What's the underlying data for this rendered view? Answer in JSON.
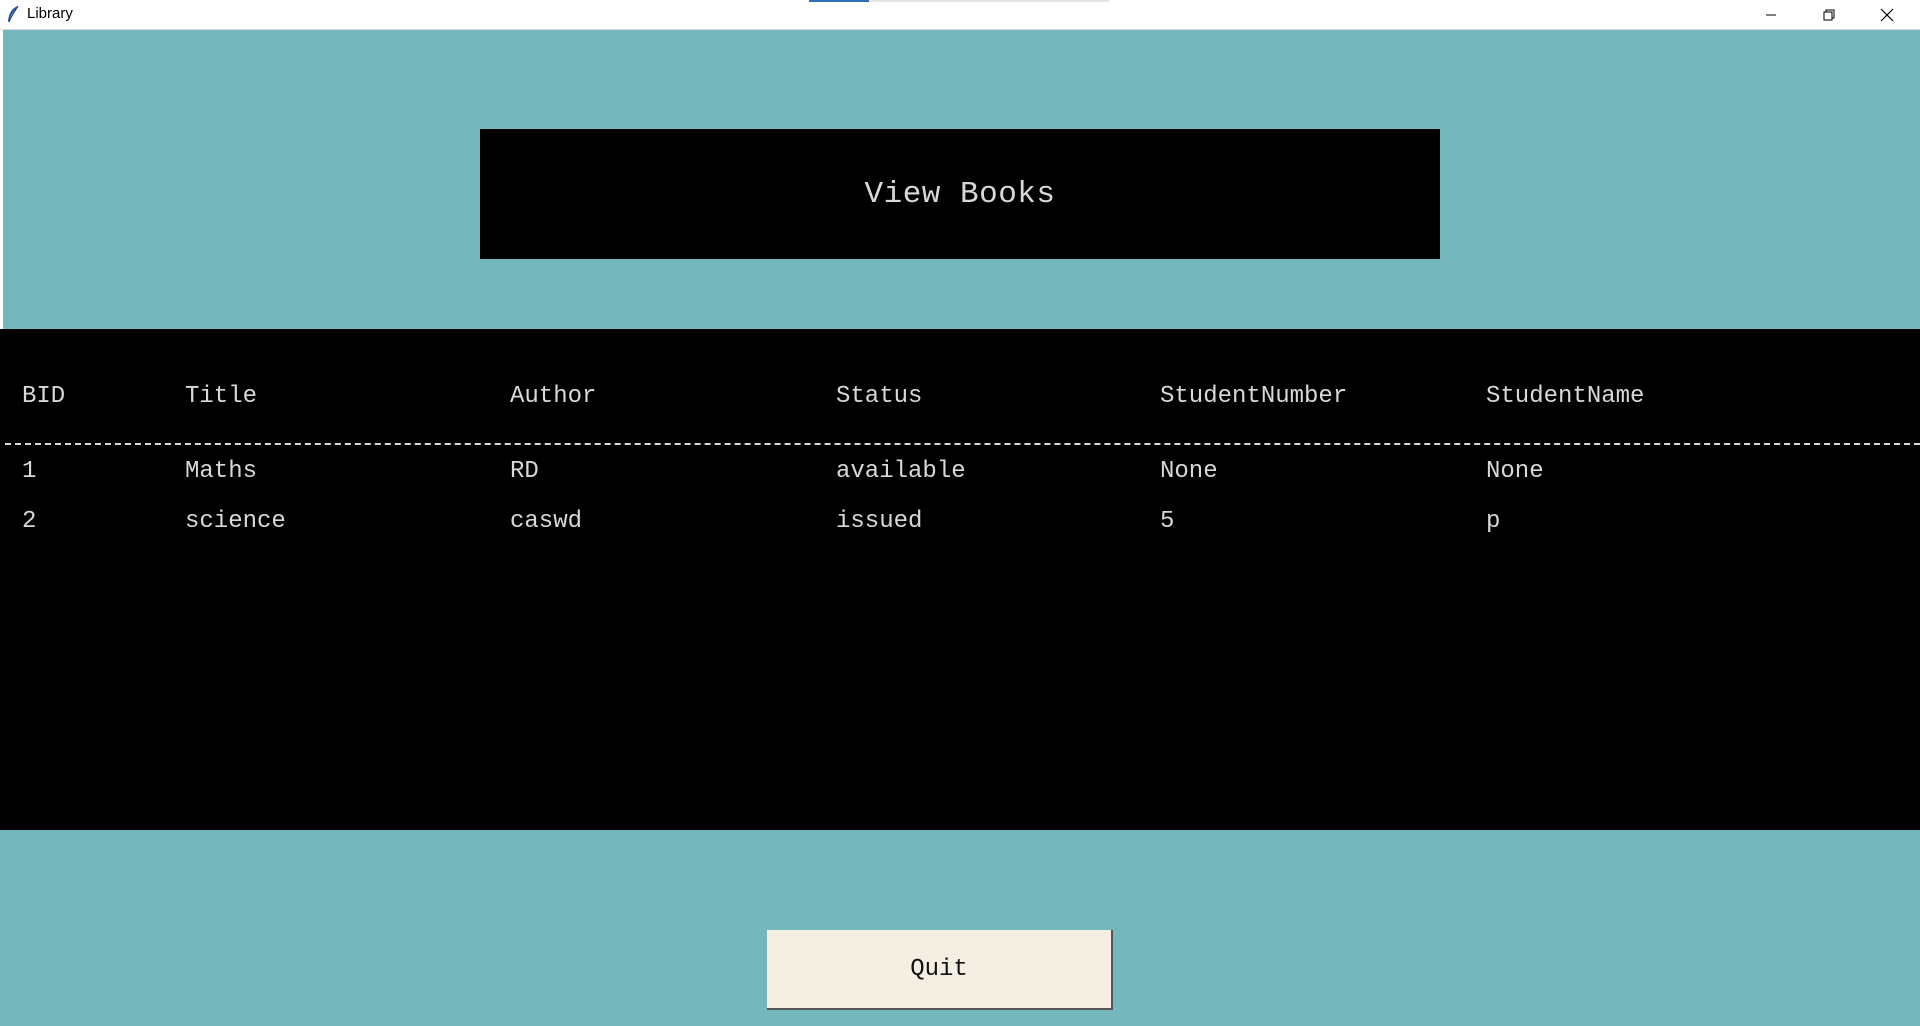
{
  "window": {
    "title": "Library",
    "controls": [
      "minimize-icon",
      "restore-icon",
      "close-icon"
    ]
  },
  "heading": {
    "label": "View Books"
  },
  "table": {
    "columns": [
      "BID",
      "Title",
      "Author",
      "Status",
      "StudentNumber",
      "StudentName"
    ],
    "rows": [
      [
        "1",
        "Maths",
        "RD",
        "available",
        "None",
        "None"
      ],
      [
        "2",
        "science",
        "caswd",
        "issued",
        "5",
        "p"
      ]
    ]
  },
  "footer": {
    "quit_label": "Quit"
  },
  "colors": {
    "background": "#74b7bd",
    "panel": "#000000",
    "text": "#d8d8d8",
    "button": "#f5efe3"
  }
}
